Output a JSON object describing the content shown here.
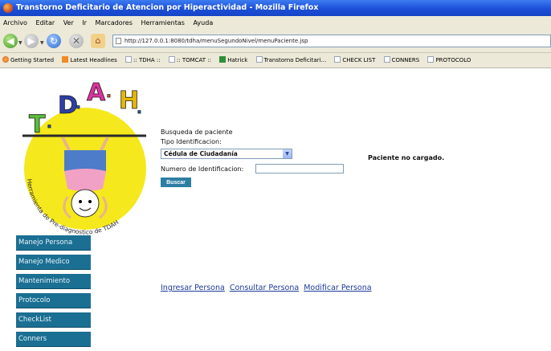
{
  "window": {
    "title": "Transtorno Deficitario de Atencion por Hiperactividad - Mozilla Firefox"
  },
  "menubar": [
    "Archivo",
    "Editar",
    "Ver",
    "Ir",
    "Marcadores",
    "Herramientas",
    "Ayuda"
  ],
  "navbar": {
    "url": "http://127.0.0.1:8080/tdha/menuSegundoNivel/menuPaciente.jsp"
  },
  "bookmarks": [
    {
      "label": "Getting Started",
      "icon": "firefox-icon"
    },
    {
      "label": "Latest Headlines",
      "icon": "rss-icon"
    },
    {
      "label": ":: TDHA ::",
      "icon": "page-icon"
    },
    {
      "label": ":: TOMCAT ::",
      "icon": "page-icon"
    },
    {
      "label": "Hatrick",
      "icon": "green-icon"
    },
    {
      "label": "Transtorno Deficitari...",
      "icon": "page-icon"
    },
    {
      "label": "CHECK LIST",
      "icon": "page-icon"
    },
    {
      "label": "CONNERS",
      "icon": "page-icon"
    },
    {
      "label": "PROTOCOLO",
      "icon": "page-icon"
    }
  ],
  "logo": {
    "letters": [
      "T",
      ".",
      "D",
      ".",
      "A",
      ".",
      "H",
      "."
    ],
    "colors": [
      "#5bbf3a",
      "#1e5fbf",
      "#2c3fa8",
      "#1e5fbf",
      "#d8349c",
      "#e65c1a",
      "#e6b800",
      "#1e5fbf"
    ],
    "arc_text": "Herramienta de Pre-diagnostico de TDAH"
  },
  "side_menu": [
    "Manejo Persona",
    "Manejo Medico",
    "Mantenimiento",
    "Protocolo",
    "CheckList",
    "Conners"
  ],
  "search": {
    "title": "Busqueda de paciente",
    "tipo_label": "Tipo Identificacion:",
    "tipo_value": "Cédula de Ciudadanía",
    "numero_label": "Numero de Identificacion:",
    "numero_value": "",
    "button": "Buscar"
  },
  "status": "Paciente no cargado.",
  "bottom_links": [
    "Ingresar Persona",
    "Consultar Persona",
    "Modificar Persona"
  ]
}
